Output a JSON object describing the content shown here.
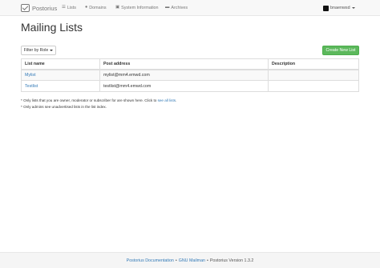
{
  "navbar": {
    "brand": "Postorius",
    "items": [
      {
        "label": "Lists",
        "icon": "list-icon"
      },
      {
        "label": "Domains",
        "icon": "globe-icon"
      },
      {
        "label": "System Information",
        "icon": "info-icon"
      },
      {
        "label": "Archives",
        "icon": "comment-icon"
      }
    ],
    "user": "bnaenwsd"
  },
  "page": {
    "title": "Mailing Lists",
    "filter_label": "Filter by Role",
    "create_label": "Create New List"
  },
  "table": {
    "headers": {
      "name": "List name",
      "address": "Post address",
      "description": "Description"
    },
    "rows": [
      {
        "name": "Mylist",
        "address": "mylist@mm4.emwd.com",
        "description": ""
      },
      {
        "name": "Testlist",
        "address": "testlist@mm4.emwd.com",
        "description": ""
      }
    ]
  },
  "notes": {
    "note1_prefix": "* Only lists that you are owner, moderator or subscriber for are shown here. Click to",
    "note1_link": "see all lists",
    "note1_suffix": ".",
    "note2": "* Only admins see unadvertised lists in the list index."
  },
  "footer": {
    "link1": "Postorius Documentation",
    "separator": "•",
    "link2": "GNU Mailman",
    "version": "Postorius Version 1.3.2"
  },
  "colors": {
    "primary_link": "#337ab7",
    "success_button": "#5cb85c"
  }
}
